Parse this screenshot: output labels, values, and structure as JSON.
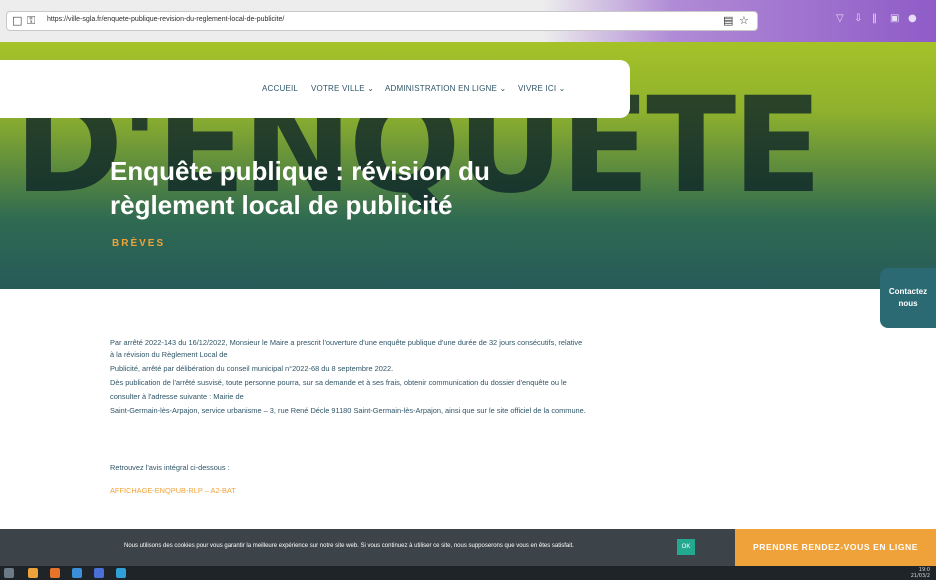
{
  "browser": {
    "url": "https://ville-sgla.fr/enquete-publique-revision-du-reglement-local-de-publicite/",
    "left_icons": [
      "page-icon",
      "lock-icon"
    ],
    "right_icons": [
      "reader-view-icon",
      "bookmark-star-icon"
    ],
    "toolbar_icons": [
      "pocket-icon",
      "download-icon",
      "library-icon",
      "sidebar-icon",
      "account-icon"
    ]
  },
  "nav": {
    "items": [
      "ACCUEIL",
      "VOTRE VILLE ⌄",
      "ADMINISTRATION EN LIGNE ⌄",
      "VIVRE ICI ⌄"
    ]
  },
  "hero": {
    "background_word": "D'ENQUÊTE",
    "title": "Enquête publique : révision du règlement local de publicité",
    "category": "BRÈVES"
  },
  "contact_tab": {
    "line1": "Contactez",
    "line2": "nous"
  },
  "content": {
    "lines": [
      "Par arrêté 2022-143 du 16/12/2022, Monsieur le Maire a prescrit l'ouverture d'une enquête publique d'une durée de 32 jours consécutifs, relative",
      "à la révision du Règlement Local de",
      "Publicité, arrêté par délibération du conseil municipal n°2022-68 du 8 septembre 2022.",
      "Dès publication de l'arrêté susvisé, toute personne pourra, sur sa demande et à ses frais, obtenir communication du dossier d'enquête ou le",
      "consulter à l'adresse suivante : Mairie de",
      "Saint-Germain-lès-Arpajon, service urbanisme – 3, rue René Décle 91180 Saint-Germain-lès-Arpajon, ainsi que sur le site officiel de la commune."
    ],
    "retrouvez": "Retrouvez l'avis intégral ci-dessous :",
    "link": "AFFICHAGE-ENQPUB-RLP – A2-BAT"
  },
  "cookie": {
    "text": "Nous utilisons des cookies pour vous garantir la meilleure expérience sur notre site web. Si vous continuez à utiliser ce site, nous supposerons que vous en êtes satisfait.",
    "ok": "OK"
  },
  "cta": {
    "label": "PRENDRE RENDEZ-VOUS EN LIGNE"
  },
  "taskbar": {
    "time": "19:0",
    "date": "21/03/2"
  },
  "colors": {
    "accent": "#f0a23a",
    "nav_text": "#2f5567",
    "contact_bg": "#2b6a73",
    "cookie_bg": "#3c4449",
    "ok_bg": "#22a98f"
  }
}
